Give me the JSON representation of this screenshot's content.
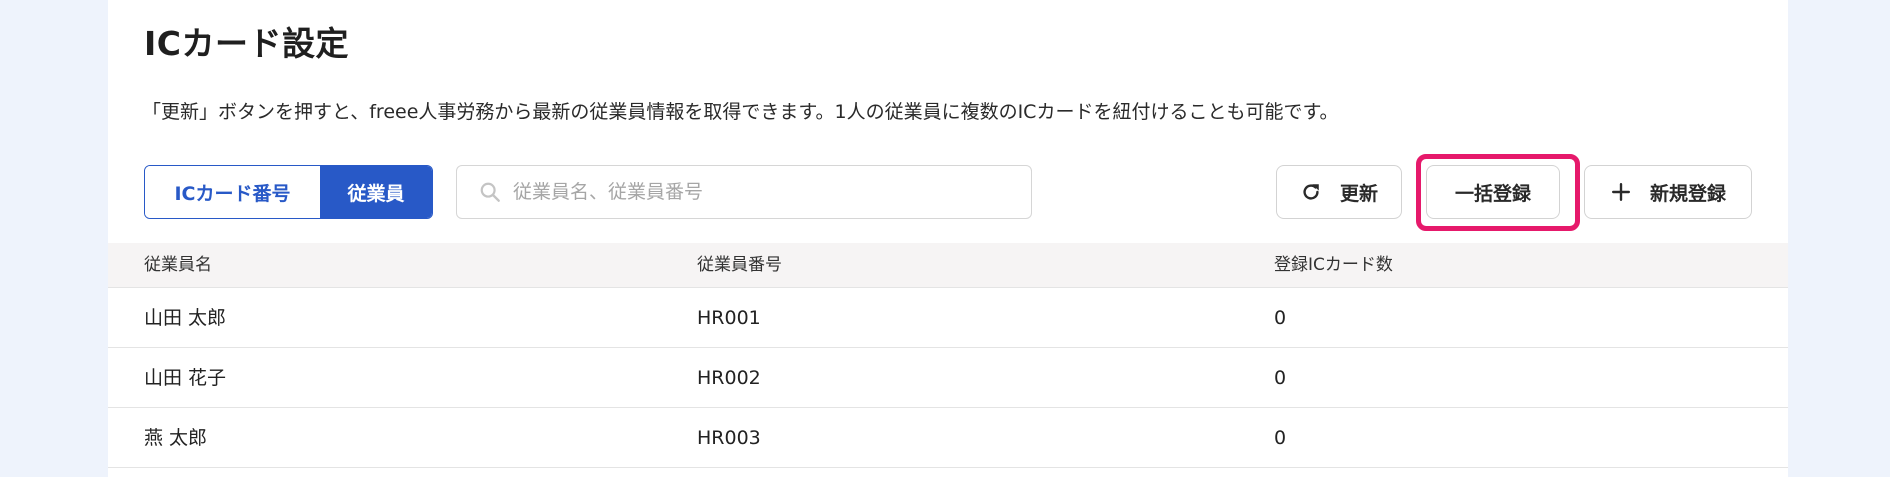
{
  "page": {
    "title": "ICカード設定",
    "description": "「更新」ボタンを押すと、freee人事労務から最新の従業員情報を取得できます。1人の従業員に複数のICカードを紐付けることも可能です。"
  },
  "toggle": {
    "options": [
      "ICカード番号",
      "従業員"
    ],
    "selected": "従業員"
  },
  "search": {
    "placeholder": "従業員名、従業員番号",
    "value": ""
  },
  "actions": {
    "refresh_label": "更新",
    "bulk_register_label": "一括登録",
    "new_register_label": "新規登録"
  },
  "table": {
    "columns": [
      "従業員名",
      "従業員番号",
      "登録ICカード数"
    ],
    "rows": [
      {
        "name": "山田 太郎",
        "id": "HR001",
        "count": "0"
      },
      {
        "name": "山田 花子",
        "id": "HR002",
        "count": "0"
      },
      {
        "name": "燕 太郎",
        "id": "HR003",
        "count": "0"
      }
    ]
  },
  "colors": {
    "primary": "#2859c7",
    "highlight": "#e6196b",
    "background": "#eef3fc",
    "header_bg": "#f6f4f4"
  },
  "icons": {
    "search": "search-icon",
    "refresh": "refresh-icon",
    "add": "plus-icon"
  }
}
